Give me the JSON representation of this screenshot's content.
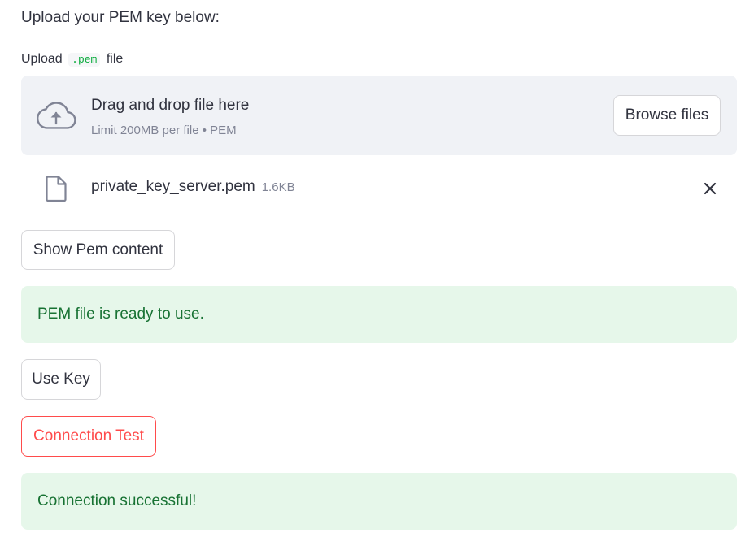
{
  "intro_text": "Upload your PEM key below:",
  "uploader": {
    "label_prefix": "Upload",
    "label_code": ".pem",
    "label_suffix": "file",
    "dropzone_title": "Drag and drop file here",
    "dropzone_subtitle": "Limit 200MB per file • PEM",
    "browse_label": "Browse files",
    "icon": "cloud-upload-icon"
  },
  "uploaded_file": {
    "name": "private_key_server.pem",
    "size": "1.6KB",
    "icon": "file-icon",
    "remove_icon": "close-icon"
  },
  "buttons": {
    "show_pem": "Show Pem content",
    "use_key": "Use Key",
    "connection_test": "Connection Test"
  },
  "alerts": {
    "ready": "PEM file is ready to use.",
    "success": "Connection successful!"
  },
  "colors": {
    "text": "#31333f",
    "muted": "#808495",
    "dropzone_bg": "#f0f2f6",
    "success_bg": "#e6f7ea",
    "success_text": "#177233",
    "danger": "#ff4b4b",
    "code_green": "#09ab3b"
  }
}
